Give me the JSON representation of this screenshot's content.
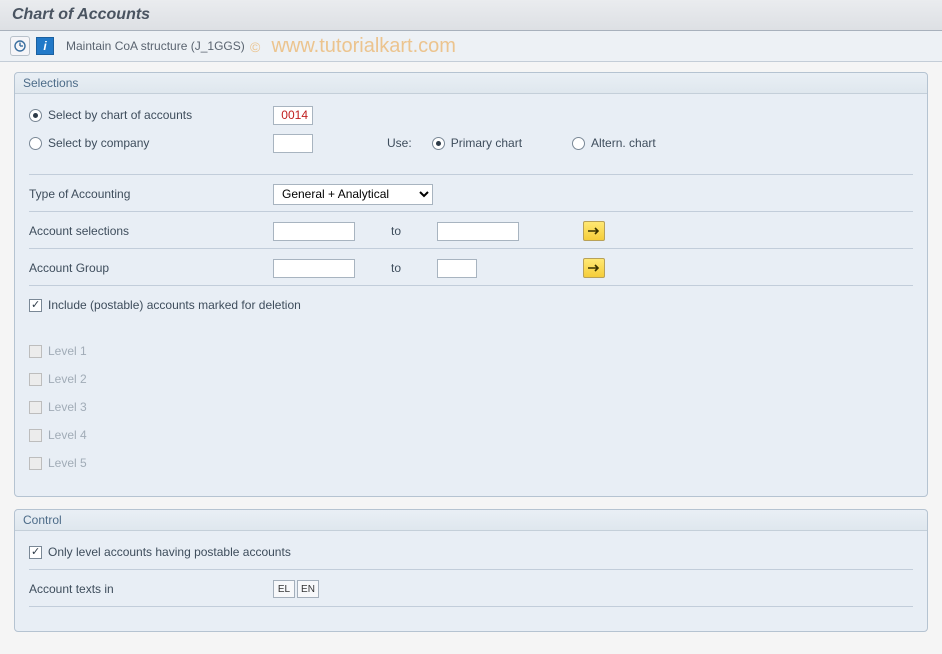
{
  "title": "Chart of Accounts",
  "toolbar": {
    "maintain_text": "Maintain CoA structure (J_1GGS)"
  },
  "watermark": {
    "copy": "©",
    "text": "www.tutorialkart.com"
  },
  "selections": {
    "header": "Selections",
    "radio_by_coa": "Select by chart of accounts",
    "radio_by_company": "Select by company",
    "coa_value": "0014",
    "company_value": "",
    "use_label": "Use:",
    "radio_primary": "Primary chart",
    "radio_altern": "Altern. chart",
    "type_of_accounting": "Type of Accounting",
    "type_value": "General + Analytical",
    "account_selections": "Account selections",
    "account_group": "Account Group",
    "to": "to",
    "include_deletion": "Include (postable) accounts marked for deletion",
    "level1": "Level 1",
    "level2": "Level 2",
    "level3": "Level 3",
    "level4": "Level 4",
    "level5": "Level 5"
  },
  "control": {
    "header": "Control",
    "only_level": "Only level accounts having postable accounts",
    "account_texts_in": "Account texts in",
    "lang_el": "EL",
    "lang_en": "EN"
  }
}
